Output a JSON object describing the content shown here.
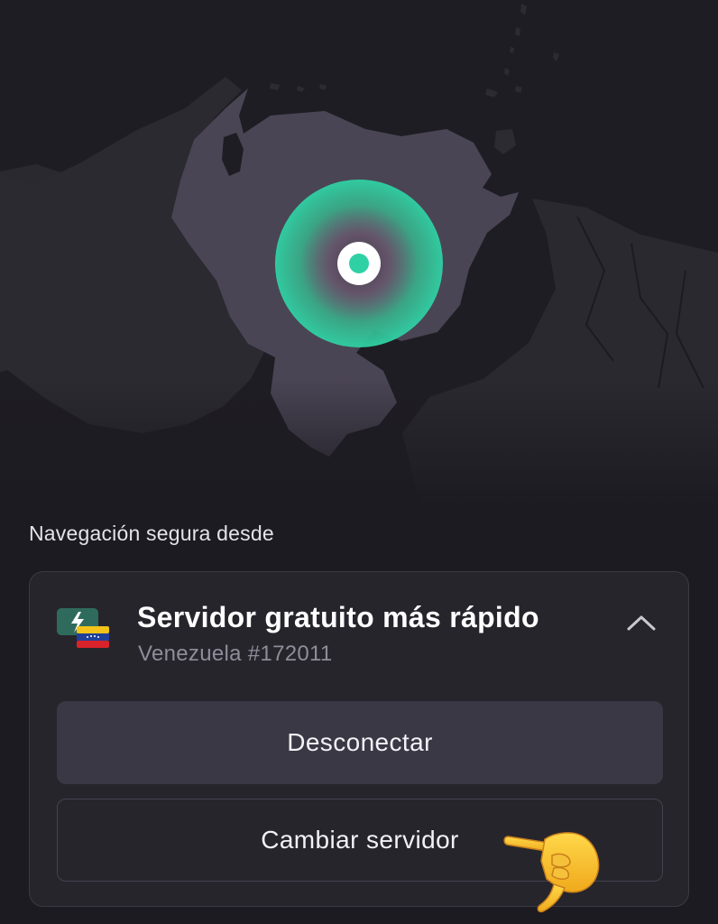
{
  "section": {
    "label": "Navegación segura desde"
  },
  "server": {
    "title": "Servidor gratuito más rápido",
    "subtitle": "Venezuela #172011"
  },
  "buttons": {
    "disconnect": "Desconectar",
    "change_server": "Cambiar servidor"
  },
  "icons": {
    "server_icon": "fastest-server-lightning-icon",
    "flag": "venezuela-flag-icon",
    "collapse": "chevron-up-icon",
    "pointer": "pointing-hand-icon"
  },
  "colors": {
    "background": "#1c1b21",
    "map_land": "#2a2930",
    "map_highlight": "#4b4554",
    "accent": "#2fd1a4",
    "card": "#26252c",
    "button": "#3a3844"
  }
}
